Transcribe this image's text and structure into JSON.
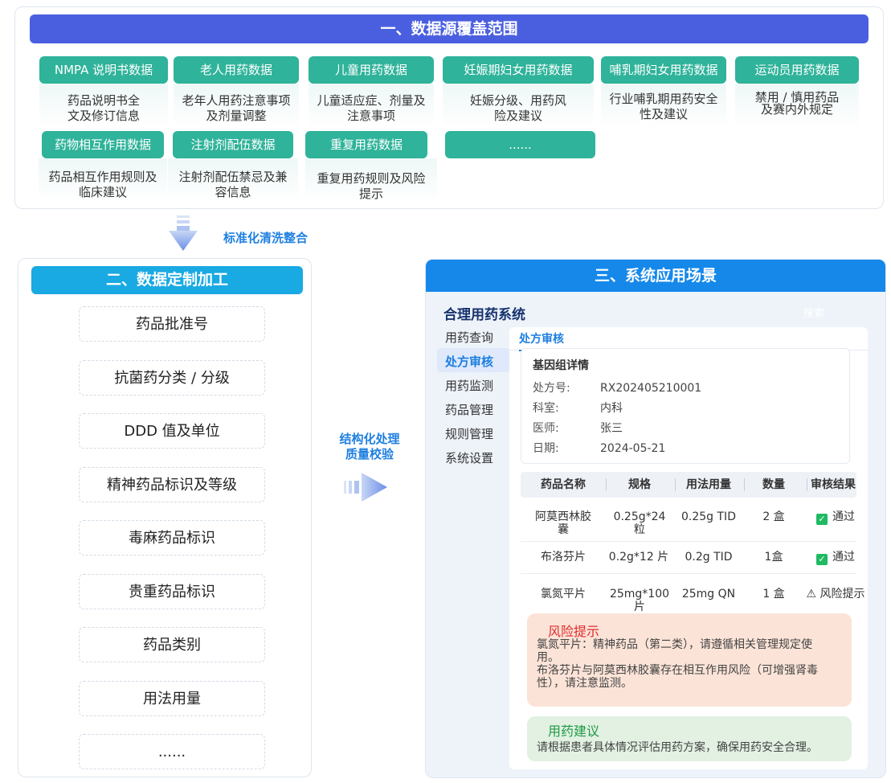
{
  "section1": {
    "title": "一、数据源覆盖范围",
    "categories": [
      {
        "label": "NMPA 说明书数据",
        "desc1": "药品说明书全",
        "desc2": "文及修订信息"
      },
      {
        "label": "老人用药数据",
        "desc1": "老年人用药注意事项",
        "desc2": "及剂量调整"
      },
      {
        "label": "儿童用药数据",
        "desc1": "儿童适应症、剂量及",
        "desc2": "注意事项"
      },
      {
        "label": "妊娠期妇女用药数据",
        "desc1": "妊娠分级、用药风",
        "desc2": "险及建议"
      },
      {
        "label": "哺乳期妇女用药数据",
        "desc1": "行业哺乳期用药安全",
        "desc2": "性及建议"
      },
      {
        "label": "运动员用药数据",
        "desc1": "禁用 / 慎用药品",
        "desc2": "及赛内外规定"
      },
      {
        "label": "药物相互作用数据",
        "desc1": "药品相互作用规则及",
        "desc2": "临床建议"
      },
      {
        "label": "注射剂配伍数据",
        "desc1": "注射剂配伍禁忌及兼",
        "desc2": "容信息"
      },
      {
        "label": "重复用药数据",
        "desc1": "重复用药规则及风险",
        "desc2": "提示"
      },
      {
        "label": "......",
        "desc1": "",
        "desc2": ""
      }
    ]
  },
  "arrow1_label": "标准化清洗整合",
  "section2": {
    "title": "二、数据定制加工",
    "items": [
      "药品批准号",
      "抗菌药分类 / 分级",
      "DDD 值及单位",
      "精神药品标识及等级",
      "毒麻药品标识",
      "贵重药品标识",
      "药品类别",
      "用法用量",
      "......"
    ]
  },
  "middle_label": {
    "line1": "结构化处理",
    "line2": "质量校验"
  },
  "section3": {
    "title": "三、系统应用场景",
    "app_title": "合理用药系统",
    "search": "搜索",
    "nav": [
      "用药查询",
      "处方审核",
      "用药监测",
      "药品管理",
      "规则管理",
      "系统设置"
    ],
    "active_tab": "处方审核",
    "info": {
      "title": "基因组详情",
      "rows": [
        {
          "k": "处方号:",
          "v": "RX202405210001"
        },
        {
          "k": "科室:",
          "v": "内科"
        },
        {
          "k": "医师:",
          "v": "张三"
        },
        {
          "k": "日期:",
          "v": "2024-05-21"
        }
      ]
    },
    "table": {
      "headers": [
        "药品名称",
        "规格",
        "用法用量",
        "数量",
        "审核结果"
      ],
      "rows": [
        {
          "name1": "阿莫西林胶",
          "name2": "囊",
          "spec1": "0.25g*24",
          "spec2": "粒",
          "usage": "0.25g TID",
          "qty": "2 盒",
          "result": "通过"
        },
        {
          "name1": "布洛芬片",
          "name2": "",
          "spec1": "0.2g*12 片",
          "spec2": "",
          "usage": "0.2g TID",
          "qty": "1盒",
          "result": "通过"
        },
        {
          "name1": "氯氮平片",
          "name2": "",
          "spec1": "25mg*100",
          "spec2": "片",
          "usage": "25mg QN",
          "qty": "1 盒",
          "result": "⚠ 风险提示"
        }
      ]
    },
    "risk": {
      "title": "风险提示",
      "line1": "氯氮平片：精神药品（第二类），请遵循相关管理规定使",
      "line2": "用。",
      "line3": "布洛芬片与阿莫西林胶囊存在相互作用风险（可增强肾毒",
      "line4": "性），请注意监测。"
    },
    "advice": {
      "title": "用药建议",
      "text": "请根据患者具体情况评估用药方案，确保用药安全合理。"
    }
  },
  "colors": {
    "indigo": "#4a5fe0",
    "teal": "#2fb39a",
    "cyan": "#19a9e3",
    "blue": "#1588ea",
    "pass": "#1fba62",
    "risk": "#e02b2b"
  }
}
